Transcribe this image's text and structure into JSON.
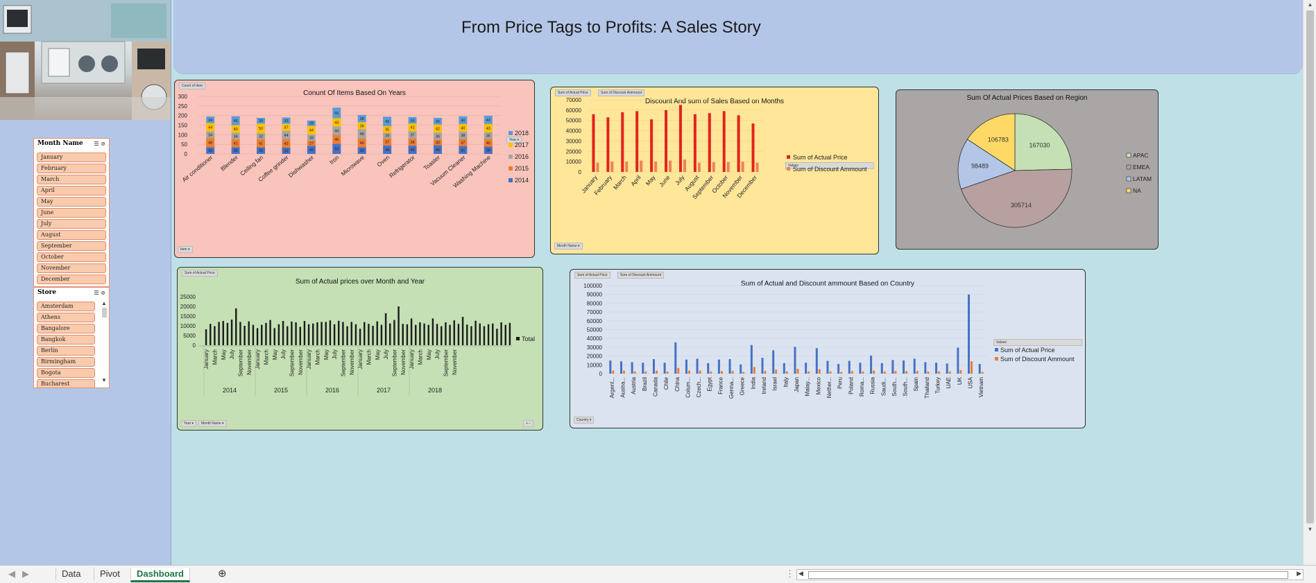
{
  "title": "From Price Tags to Profits: A Sales Story",
  "colors": {
    "y2018": "#5b9bd5",
    "y2017": "#ffc000",
    "y2016": "#a5a5a5",
    "y2015": "#ed7d31",
    "y2014": "#4472c4",
    "red": "#e3231b",
    "salmon": "#f08058",
    "blue": "#4472c4",
    "orange": "#ed7d31"
  },
  "slicers": {
    "month": {
      "header": "Month Name",
      "items": [
        "January",
        "February",
        "March",
        "April",
        "May",
        "June",
        "July",
        "August",
        "September",
        "October",
        "November",
        "December"
      ]
    },
    "store": {
      "header": "Store",
      "items": [
        "Amsterdam",
        "Athens",
        "Bangalore",
        "Bangkok",
        "Berlin",
        "Birmingham",
        "Bogota",
        "Bucharest"
      ]
    }
  },
  "tabs": [
    {
      "label": "Data"
    },
    {
      "label": "Pivot"
    },
    {
      "label": "Dashboard",
      "active": true
    }
  ],
  "chart_data": [
    {
      "id": "items-by-years",
      "type": "bar",
      "stacked": true,
      "title": "Conunt Of Items Based On Years",
      "field_buttons": {
        "value": "Count of Item",
        "legend": "Year",
        "axis": "Item"
      },
      "categories": [
        "Air conditioner",
        "Blender",
        "Ceiling fan",
        "Coffee grinder",
        "Dishwasher",
        "Iron",
        "Microwave",
        "Oven",
        "Refrigerator",
        "Toaster",
        "Vacuum Cleaner",
        "Washing Machine"
      ],
      "series": [
        {
          "name": "2014",
          "values": [
            35,
            35,
            35,
            33,
            42,
            53,
            35,
            44,
            43,
            45,
            41,
            38
          ]
        },
        {
          "name": "2015",
          "values": [
            48,
            41,
            41,
            43,
            27,
            46,
            46,
            37,
            38,
            30,
            37,
            40
          ]
        },
        {
          "name": "2016",
          "values": [
            34,
            34,
            32,
            44,
            33,
            44,
            48,
            29,
            37,
            36,
            38,
            35
          ]
        },
        {
          "name": "2017",
          "values": [
            44,
            40,
            50,
            37,
            44,
            43,
            36,
            35,
            41,
            42,
            40,
            43
          ]
        },
        {
          "name": "2018",
          "values": [
            34,
            46,
            30,
            33,
            28,
            55,
            38,
            49,
            33,
            35,
            40,
            43
          ]
        }
      ],
      "yticks": [
        "0",
        "50",
        "100",
        "150",
        "200",
        "250",
        "300"
      ],
      "ylim": [
        0,
        300
      ]
    },
    {
      "id": "discount-sales-months",
      "type": "bar",
      "title": "Discount And sum of Sales Based on Months",
      "field_buttons": {
        "value1": "Sum of Actual Price",
        "value2": "Sum of Discount Ammount",
        "legend": "Values",
        "axis": "Month Name"
      },
      "categories": [
        "January",
        "February",
        "March",
        "April",
        "May",
        "June",
        "July",
        "August",
        "September",
        "October",
        "November",
        "December"
      ],
      "series": [
        {
          "name": "Sum of Actual Price",
          "values": [
            56000,
            53000,
            58000,
            59000,
            51000,
            60000,
            65000,
            56000,
            57000,
            59000,
            55000,
            47000
          ]
        },
        {
          "name": "Sum of Discount Ammount",
          "values": [
            9000,
            10000,
            10000,
            11000,
            10000,
            11000,
            12000,
            9000,
            9500,
            9500,
            10000,
            9000
          ]
        }
      ],
      "yticks": [
        "0",
        "10000",
        "20000",
        "30000",
        "40000",
        "50000",
        "60000",
        "70000"
      ],
      "ylim": [
        0,
        70000
      ]
    },
    {
      "id": "prices-by-region",
      "type": "pie",
      "title": "Sum Of Actual Prices Based on Region",
      "labels": [
        "APAC",
        "EMEA",
        "LATAM",
        "NA"
      ],
      "values": [
        167030,
        305714,
        98489,
        106783
      ],
      "value_labels": [
        "167030",
        "305714",
        "98489",
        "106783"
      ]
    },
    {
      "id": "prices-month-year",
      "type": "bar",
      "title": "Sum of Actual prices over Month and Year",
      "field_buttons": {
        "value": "Sum of Actual Price",
        "f1": "Year",
        "f2": "Month Name"
      },
      "series_name": "Total",
      "years": [
        "2014",
        "2015",
        "2016",
        "2017",
        "2018"
      ],
      "month_labels": [
        "January",
        "March",
        "May",
        "July",
        "September",
        "November"
      ],
      "values": [
        8200,
        11000,
        9800,
        12000,
        12500,
        11500,
        13200,
        19000,
        12000,
        10000,
        12300,
        10500,
        8800,
        10500,
        11500,
        13000,
        8800,
        10800,
        12500,
        9800,
        12200,
        11800,
        9500,
        12500,
        10800,
        11200,
        11800,
        12000,
        12000,
        12800,
        10800,
        12600,
        12000,
        9800,
        12000,
        10800,
        8500,
        11900,
        11000,
        10000,
        12300,
        10500,
        16500,
        11200,
        13000,
        20000,
        11000,
        10800,
        13800,
        10500,
        11800,
        11200,
        10500,
        13800,
        11000,
        9800,
        11800,
        10500,
        12800,
        11000,
        14600,
        10600,
        9800,
        12600,
        11200,
        9800,
        10800,
        11200,
        8500,
        11800,
        10500,
        11500
      ],
      "yticks": [
        "0",
        "5000",
        "10000",
        "15000",
        "20000",
        "25000"
      ],
      "ylim": [
        0,
        25000
      ]
    },
    {
      "id": "actual-discount-country",
      "type": "bar",
      "title": "Sum of Actual and Discount ammount Based on Country",
      "field_buttons": {
        "value1": "Sum of Actual Price",
        "value2": "Sum of Discount Ammount",
        "legend": "Values",
        "axis": "Country"
      },
      "categories": [
        "Argent...",
        "Austra...",
        "Austria",
        "Brazil",
        "Canada",
        "Chile",
        "China",
        "Colum...",
        "Czech...",
        "Egypt",
        "France",
        "Germa...",
        "Greece",
        "India",
        "Ireland",
        "Israel",
        "Italy",
        "Japan",
        "Malay...",
        "Mexico",
        "Nether...",
        "Peru",
        "Poland",
        "Roma...",
        "Russia",
        "Saudi...",
        "South...",
        "South...",
        "Spain",
        "Thailand",
        "Turkey",
        "UAE",
        "UK",
        "USA",
        "Vietnam"
      ],
      "series": [
        {
          "name": "Sum of Actual Price",
          "values": [
            15000,
            14000,
            13000,
            12500,
            16500,
            12500,
            35500,
            16000,
            17000,
            12000,
            16000,
            16500,
            10500,
            32500,
            18000,
            26500,
            12000,
            30500,
            12500,
            29000,
            14500,
            11000,
            14500,
            12500,
            20500,
            12000,
            15500,
            15000,
            17000,
            13000,
            12500,
            11500,
            29500,
            90000,
            11000
          ]
        },
        {
          "name": "Sum of Discount Ammount",
          "values": [
            3500,
            3500,
            2500,
            2500,
            3500,
            2500,
            6500,
            3500,
            3500,
            2500,
            3000,
            3000,
            2000,
            7500,
            3000,
            4500,
            2500,
            5500,
            2500,
            5000,
            2500,
            2000,
            3000,
            2500,
            3500,
            2500,
            3000,
            3000,
            3000,
            2500,
            2500,
            2500,
            4000,
            14000,
            2000
          ]
        }
      ],
      "yticks": [
        "0",
        "10000",
        "20000",
        "30000",
        "40000",
        "50000",
        "60000",
        "70000",
        "80000",
        "90000",
        "100000"
      ],
      "ylim": [
        0,
        100000
      ]
    }
  ]
}
